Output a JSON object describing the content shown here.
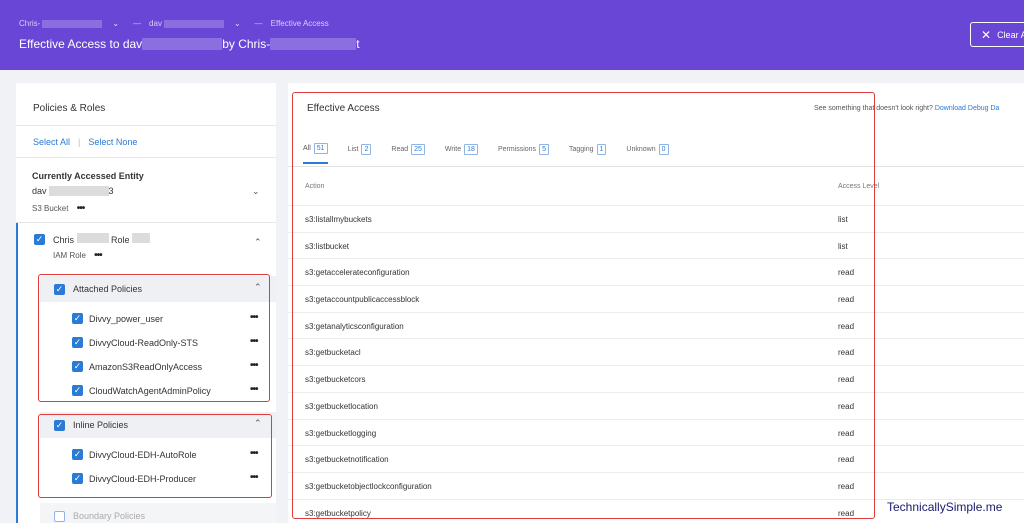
{
  "header": {
    "crumb1": "Chris-",
    "crumb2": "dav",
    "crumb3": "Effective Access",
    "title_prefix": "Effective Access to dav",
    "title_mid": "by Chris-",
    "title_suffix": "t",
    "clear_label": "Clear A"
  },
  "left": {
    "title": "Policies & Roles",
    "select_all": "Select All",
    "select_none": "Select None",
    "entity_label": "Currently Accessed Entity",
    "entity_name_prefix": "dav",
    "entity_name_suffix": "3",
    "entity_type": "S3 Bucket",
    "role_prefix": "Chris",
    "role_mid": "Role",
    "role_type": "IAM Role",
    "attached_label": "Attached Policies",
    "attached": [
      "Divvy_power_user",
      "DivvyCloud-ReadOnly-STS",
      "AmazonS3ReadOnlyAccess",
      "CloudWatchAgentAdminPolicy"
    ],
    "inline_label": "Inline Policies",
    "inline": [
      "DivvyCloud-EDH-AutoRole",
      "DivvyCloud-EDH-Producer"
    ],
    "boundary_label": "Boundary Policies"
  },
  "right": {
    "title": "Effective Access",
    "feedback_text": "See something that doesn't look right?",
    "feedback_link": "Download Debug Da",
    "tabs": [
      {
        "label": "All",
        "count": "51"
      },
      {
        "label": "List",
        "count": "2"
      },
      {
        "label": "Read",
        "count": "25"
      },
      {
        "label": "Write",
        "count": "18"
      },
      {
        "label": "Permissions",
        "count": "5"
      },
      {
        "label": "Tagging",
        "count": "1"
      },
      {
        "label": "Unknown",
        "count": "0"
      }
    ],
    "col_action": "Action",
    "col_level": "Access Level",
    "rows": [
      {
        "action": "s3:listallmybuckets",
        "level": "list"
      },
      {
        "action": "s3:listbucket",
        "level": "list"
      },
      {
        "action": "s3:getaccelerateconfiguration",
        "level": "read"
      },
      {
        "action": "s3:getaccountpublicaccessblock",
        "level": "read"
      },
      {
        "action": "s3:getanalyticsconfiguration",
        "level": "read"
      },
      {
        "action": "s3:getbucketacl",
        "level": "read"
      },
      {
        "action": "s3:getbucketcors",
        "level": "read"
      },
      {
        "action": "s3:getbucketlocation",
        "level": "read"
      },
      {
        "action": "s3:getbucketlogging",
        "level": "read"
      },
      {
        "action": "s3:getbucketnotification",
        "level": "read"
      },
      {
        "action": "s3:getbucketobjectlockconfiguration",
        "level": "read"
      },
      {
        "action": "s3:getbucketpolicy",
        "level": "read"
      }
    ]
  },
  "watermark": "TechnicallySimple.me"
}
